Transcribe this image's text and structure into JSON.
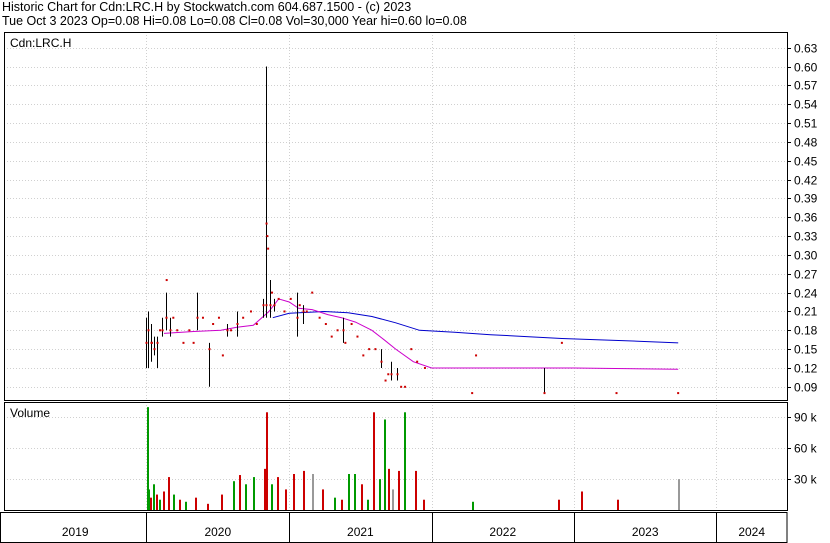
{
  "header": {
    "line1": "Historic Chart for Cdn:LRC.H by Stockwatch.com 604.687.1500 - (c) 2023",
    "line2": "Tue Oct  3 2023  Op=0.08  Hi=0.08  Lo=0.08  Cl=0.08  Vol=30,000  Year hi=0.60  lo=0.08"
  },
  "chart_data": {
    "type": "line",
    "price_panel": {
      "label": "Cdn:LRC.H",
      "y_ticks": [
        "0.63",
        "0.60",
        "0.57",
        "0.54",
        "0.51",
        "0.48",
        "0.45",
        "0.42",
        "0.39",
        "0.36",
        "0.33",
        "0.30",
        "0.27",
        "0.24",
        "0.21",
        "0.18",
        "0.15",
        "0.12",
        "0.09"
      ],
      "ylim": [
        0.069,
        0.655
      ],
      "x_ticks": [
        "2019",
        "2020",
        "2021",
        "2022",
        "2023",
        "2024"
      ],
      "xlim": [
        "2019-01-01",
        "2024-06-30"
      ],
      "ohlc_bars": [
        {
          "x": "2020-01-01",
          "hi": 0.2,
          "lo": 0.12,
          "c": 0.16
        },
        {
          "x": "2020-01-06",
          "hi": 0.21,
          "lo": 0.12,
          "c": 0.18
        },
        {
          "x": "2020-01-12",
          "hi": 0.19,
          "lo": 0.13,
          "c": 0.16
        },
        {
          "x": "2020-01-20",
          "hi": 0.17,
          "lo": 0.14,
          "c": 0.15
        },
        {
          "x": "2020-01-28",
          "hi": 0.17,
          "lo": 0.12,
          "c": 0.16
        },
        {
          "x": "2020-02-10",
          "hi": 0.2,
          "lo": 0.17,
          "c": 0.18
        },
        {
          "x": "2020-02-20",
          "hi": 0.24,
          "lo": 0.18,
          "c": 0.2
        },
        {
          "x": "2020-03-01",
          "hi": 0.2,
          "lo": 0.17,
          "c": 0.18
        },
        {
          "x": "2020-05-10",
          "hi": 0.24,
          "lo": 0.18,
          "c": 0.2
        },
        {
          "x": "2020-06-10",
          "hi": 0.16,
          "lo": 0.09,
          "c": 0.15
        },
        {
          "x": "2020-07-25",
          "hi": 0.19,
          "lo": 0.17,
          "c": 0.18
        },
        {
          "x": "2020-08-20",
          "hi": 0.21,
          "lo": 0.17,
          "c": 0.19
        },
        {
          "x": "2020-10-25",
          "hi": 0.23,
          "lo": 0.2,
          "c": 0.22
        },
        {
          "x": "2020-11-02",
          "hi": 0.6,
          "lo": 0.2,
          "c": 0.22
        },
        {
          "x": "2020-11-12",
          "hi": 0.26,
          "lo": 0.2,
          "c": 0.22
        },
        {
          "x": "2020-11-22",
          "hi": 0.23,
          "lo": 0.21,
          "c": 0.22
        },
        {
          "x": "2021-01-20",
          "hi": 0.24,
          "lo": 0.17,
          "c": 0.2
        },
        {
          "x": "2021-02-05",
          "hi": 0.22,
          "lo": 0.19,
          "c": 0.21
        },
        {
          "x": "2021-05-20",
          "hi": 0.2,
          "lo": 0.16,
          "c": 0.18
        },
        {
          "x": "2021-08-25",
          "hi": 0.15,
          "lo": 0.12,
          "c": 0.13
        },
        {
          "x": "2021-09-20",
          "hi": 0.13,
          "lo": 0.1,
          "c": 0.11
        },
        {
          "x": "2021-10-05",
          "hi": 0.12,
          "lo": 0.1,
          "c": 0.11
        },
        {
          "x": "2022-10-15",
          "hi": 0.12,
          "lo": 0.08,
          "c": 0.08
        }
      ],
      "close_dots": [
        {
          "x": "2020-01-15",
          "y": 0.16
        },
        {
          "x": "2020-02-05",
          "y": 0.18
        },
        {
          "x": "2020-02-22",
          "y": 0.26
        },
        {
          "x": "2020-03-10",
          "y": 0.2
        },
        {
          "x": "2020-03-20",
          "y": 0.18
        },
        {
          "x": "2020-04-05",
          "y": 0.16
        },
        {
          "x": "2020-04-20",
          "y": 0.18
        },
        {
          "x": "2020-05-01",
          "y": 0.16
        },
        {
          "x": "2020-05-25",
          "y": 0.2
        },
        {
          "x": "2020-06-20",
          "y": 0.19
        },
        {
          "x": "2020-07-05",
          "y": 0.2
        },
        {
          "x": "2020-07-15",
          "y": 0.14
        },
        {
          "x": "2020-08-05",
          "y": 0.18
        },
        {
          "x": "2020-09-05",
          "y": 0.2
        },
        {
          "x": "2020-09-25",
          "y": 0.21
        },
        {
          "x": "2020-10-10",
          "y": 0.19
        },
        {
          "x": "2020-11-04",
          "y": 0.35
        },
        {
          "x": "2020-11-06",
          "y": 0.33
        },
        {
          "x": "2020-11-08",
          "y": 0.31
        },
        {
          "x": "2020-11-18",
          "y": 0.24
        },
        {
          "x": "2020-12-05",
          "y": 0.23
        },
        {
          "x": "2020-12-20",
          "y": 0.21
        },
        {
          "x": "2021-01-05",
          "y": 0.23
        },
        {
          "x": "2021-01-28",
          "y": 0.22
        },
        {
          "x": "2021-02-15",
          "y": 0.21
        },
        {
          "x": "2021-03-01",
          "y": 0.24
        },
        {
          "x": "2021-03-20",
          "y": 0.2
        },
        {
          "x": "2021-04-05",
          "y": 0.19
        },
        {
          "x": "2021-04-20",
          "y": 0.17
        },
        {
          "x": "2021-05-05",
          "y": 0.18
        },
        {
          "x": "2021-05-25",
          "y": 0.16
        },
        {
          "x": "2021-06-10",
          "y": 0.19
        },
        {
          "x": "2021-06-25",
          "y": 0.17
        },
        {
          "x": "2021-07-10",
          "y": 0.14
        },
        {
          "x": "2021-07-25",
          "y": 0.15
        },
        {
          "x": "2021-08-10",
          "y": 0.15
        },
        {
          "x": "2021-09-05",
          "y": 0.1
        },
        {
          "x": "2021-09-12",
          "y": 0.11
        },
        {
          "x": "2021-10-15",
          "y": 0.09
        },
        {
          "x": "2021-10-25",
          "y": 0.09
        },
        {
          "x": "2021-11-10",
          "y": 0.15
        },
        {
          "x": "2021-11-25",
          "y": 0.13
        },
        {
          "x": "2021-12-15",
          "y": 0.12
        },
        {
          "x": "2022-04-15",
          "y": 0.08
        },
        {
          "x": "2022-04-25",
          "y": 0.14
        },
        {
          "x": "2022-12-01",
          "y": 0.16
        },
        {
          "x": "2023-04-20",
          "y": 0.08
        },
        {
          "x": "2023-09-25",
          "y": 0.08
        }
      ],
      "series": [
        {
          "name": "",
          "color": "#0000cc",
          "points": [
            [
              "2020-11-20",
              0.2
            ],
            [
              "2021-01-01",
              0.207
            ],
            [
              "2021-04-01",
              0.21
            ],
            [
              "2021-06-01",
              0.208
            ],
            [
              "2021-08-01",
              0.202
            ],
            [
              "2021-10-01",
              0.192
            ],
            [
              "2021-12-01",
              0.18
            ],
            [
              "2022-03-01",
              0.177
            ],
            [
              "2022-06-01",
              0.173
            ],
            [
              "2022-09-01",
              0.17
            ],
            [
              "2022-12-01",
              0.167
            ],
            [
              "2023-03-01",
              0.165
            ],
            [
              "2023-06-01",
              0.163
            ],
            [
              "2023-09-25",
              0.16
            ]
          ]
        },
        {
          "name": "",
          "color": "#cc00cc",
          "points": [
            [
              "2020-02-15",
              0.175
            ],
            [
              "2020-05-01",
              0.178
            ],
            [
              "2020-07-10",
              0.18
            ],
            [
              "2020-08-20",
              0.185
            ],
            [
              "2020-10-01",
              0.188
            ],
            [
              "2020-11-10",
              0.21
            ],
            [
              "2020-12-05",
              0.23
            ],
            [
              "2021-01-01",
              0.225
            ],
            [
              "2021-01-25",
              0.215
            ],
            [
              "2021-03-01",
              0.213
            ],
            [
              "2021-04-10",
              0.205
            ],
            [
              "2021-05-15",
              0.2
            ],
            [
              "2021-06-20",
              0.193
            ],
            [
              "2021-08-01",
              0.18
            ],
            [
              "2021-09-01",
              0.165
            ],
            [
              "2021-10-01",
              0.15
            ],
            [
              "2021-11-15",
              0.13
            ],
            [
              "2022-01-01",
              0.12
            ],
            [
              "2022-06-01",
              0.12
            ],
            [
              "2023-01-01",
              0.12
            ],
            [
              "2023-09-25",
              0.118
            ]
          ]
        }
      ]
    },
    "volume_panel": {
      "label": "Volume",
      "y_ticks": [
        "90 k",
        "60 k",
        "30 k"
      ],
      "ylim": [
        0,
        105000
      ],
      "bars": [
        {
          "x": "2020-01-03",
          "v": 100000,
          "c": "#009900"
        },
        {
          "x": "2020-01-05",
          "v": 20000,
          "c": "#009900"
        },
        {
          "x": "2020-01-10",
          "v": 12000,
          "c": "#cc0000"
        },
        {
          "x": "2020-01-18",
          "v": 25000,
          "c": "#009900"
        },
        {
          "x": "2020-01-25",
          "v": 15000,
          "c": "#cc0000"
        },
        {
          "x": "2020-02-02",
          "v": 10000,
          "c": "#009900"
        },
        {
          "x": "2020-02-12",
          "v": 18000,
          "c": "#cc0000"
        },
        {
          "x": "2020-02-25",
          "v": 32000,
          "c": "#cc0000"
        },
        {
          "x": "2020-03-10",
          "v": 15000,
          "c": "#009900"
        },
        {
          "x": "2020-03-25",
          "v": 10000,
          "c": "#cc0000"
        },
        {
          "x": "2020-04-10",
          "v": 8000,
          "c": "#009900"
        },
        {
          "x": "2020-05-05",
          "v": 12000,
          "c": "#cc0000"
        },
        {
          "x": "2020-06-05",
          "v": 6000,
          "c": "#cc0000"
        },
        {
          "x": "2020-07-10",
          "v": 15000,
          "c": "#cc0000"
        },
        {
          "x": "2020-08-10",
          "v": 28000,
          "c": "#009900"
        },
        {
          "x": "2020-08-25",
          "v": 34000,
          "c": "#cc0000"
        },
        {
          "x": "2020-09-10",
          "v": 25000,
          "c": "#009900"
        },
        {
          "x": "2020-10-01",
          "v": 32000,
          "c": "#009900"
        },
        {
          "x": "2020-10-28",
          "v": 40000,
          "c": "#cc0000"
        },
        {
          "x": "2020-11-03",
          "v": 95000,
          "c": "#cc0000"
        },
        {
          "x": "2020-11-15",
          "v": 25000,
          "c": "#009900"
        },
        {
          "x": "2020-12-01",
          "v": 32000,
          "c": "#cc0000"
        },
        {
          "x": "2020-12-20",
          "v": 20000,
          "c": "#cc0000"
        },
        {
          "x": "2021-01-10",
          "v": 35000,
          "c": "#cc0000"
        },
        {
          "x": "2021-02-05",
          "v": 38000,
          "c": "#cc0000"
        },
        {
          "x": "2021-02-28",
          "v": 35000,
          "c": "#999999"
        },
        {
          "x": "2021-03-25",
          "v": 20000,
          "c": "#cc0000"
        },
        {
          "x": "2021-04-25",
          "v": 12000,
          "c": "#009900"
        },
        {
          "x": "2021-05-15",
          "v": 10000,
          "c": "#cc0000"
        },
        {
          "x": "2021-06-01",
          "v": 35000,
          "c": "#009900"
        },
        {
          "x": "2021-06-15",
          "v": 35000,
          "c": "#009900"
        },
        {
          "x": "2021-07-05",
          "v": 25000,
          "c": "#cc0000"
        },
        {
          "x": "2021-07-20",
          "v": 10000,
          "c": "#009900"
        },
        {
          "x": "2021-08-03",
          "v": 95000,
          "c": "#cc0000"
        },
        {
          "x": "2021-08-20",
          "v": 30000,
          "c": "#009900"
        },
        {
          "x": "2021-09-02",
          "v": 88000,
          "c": "#009900"
        },
        {
          "x": "2021-09-12",
          "v": 40000,
          "c": "#cc0000"
        },
        {
          "x": "2021-09-22",
          "v": 20000,
          "c": "#999999"
        },
        {
          "x": "2021-10-08",
          "v": 38000,
          "c": "#cc0000"
        },
        {
          "x": "2021-10-22",
          "v": 95000,
          "c": "#009900"
        },
        {
          "x": "2021-11-20",
          "v": 38000,
          "c": "#cc0000"
        },
        {
          "x": "2021-12-10",
          "v": 10000,
          "c": "#cc0000"
        },
        {
          "x": "2022-04-15",
          "v": 8000,
          "c": "#009900"
        },
        {
          "x": "2022-11-20",
          "v": 10000,
          "c": "#cc0000"
        },
        {
          "x": "2023-01-20",
          "v": 18000,
          "c": "#cc0000"
        },
        {
          "x": "2023-04-20",
          "v": 10000,
          "c": "#cc0000"
        },
        {
          "x": "2023-09-25",
          "v": 30000,
          "c": "#999999"
        }
      ]
    }
  }
}
